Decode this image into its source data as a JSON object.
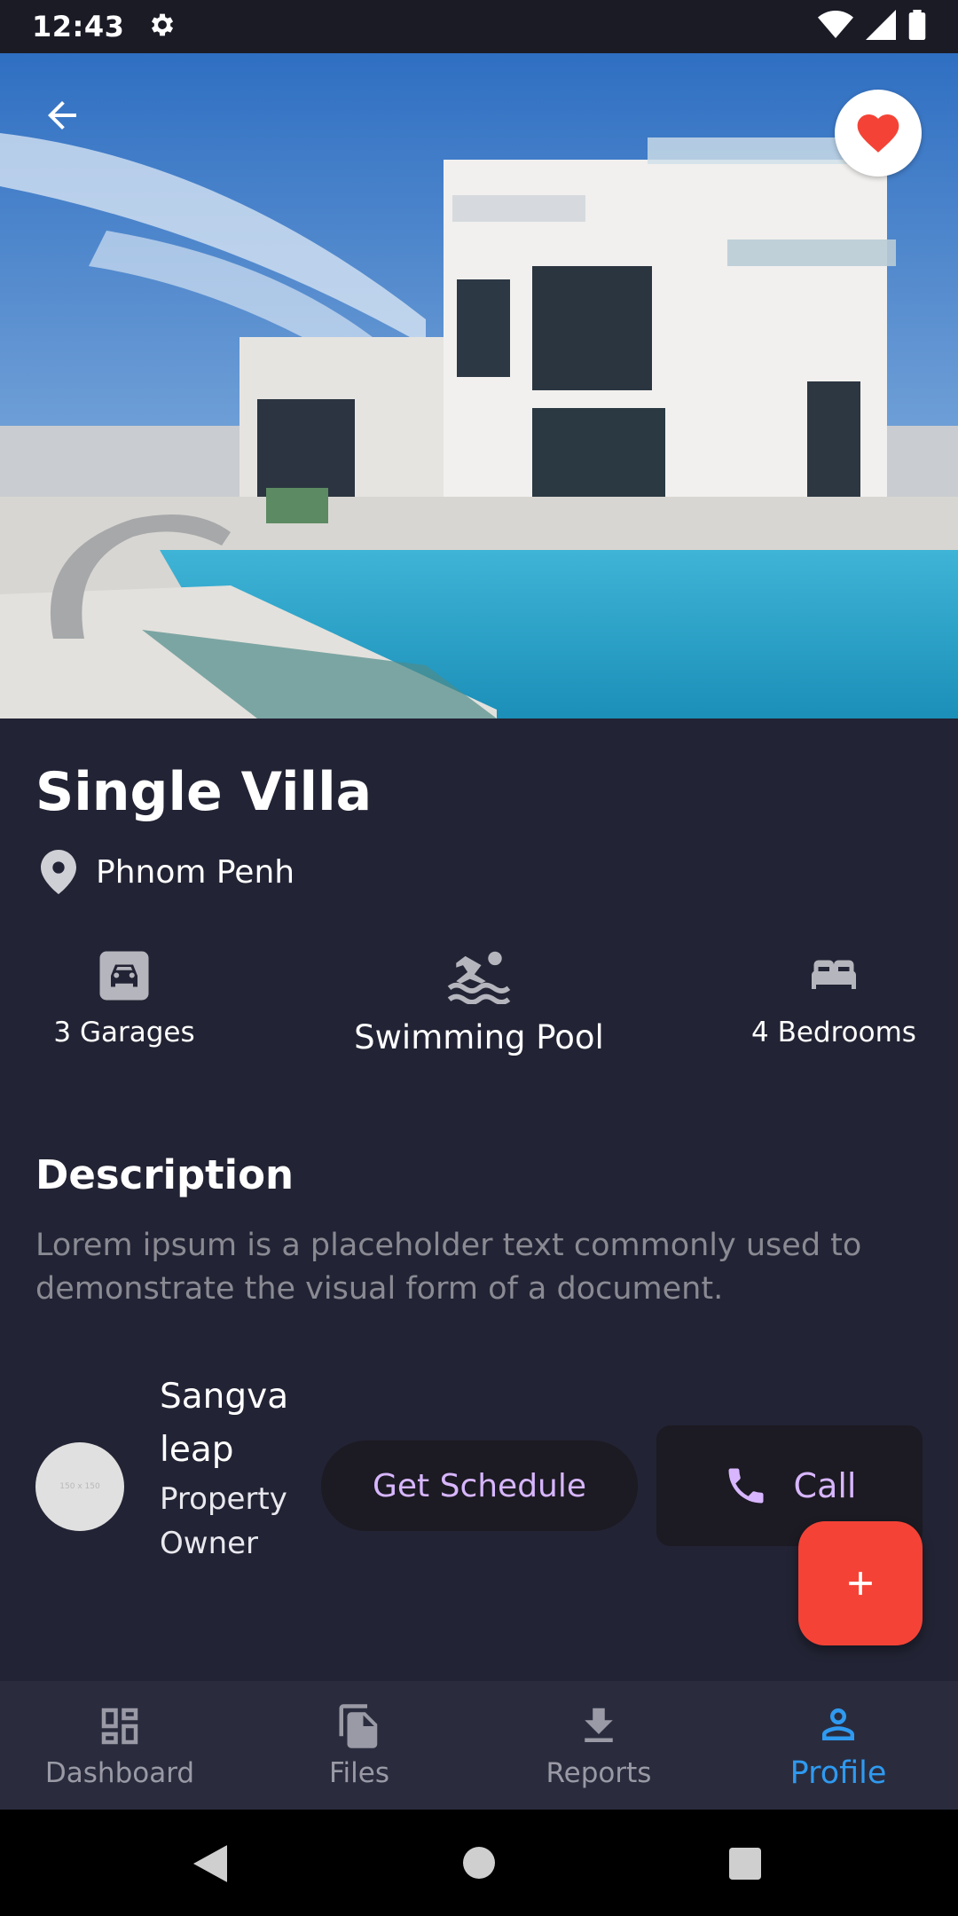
{
  "status_bar": {
    "time": "12:43"
  },
  "property": {
    "title": "Single Villa",
    "location": "Phnom Penh",
    "features": [
      {
        "label": "3 Garages",
        "icon": "garage-icon"
      },
      {
        "label": "Swimming Pool",
        "icon": "pool-icon"
      },
      {
        "label": "4 Bedrooms",
        "icon": "bed-icon"
      }
    ],
    "description_title": "Description",
    "description_text": "Lorem ipsum is a placeholder text commonly used to demonstrate the visual form of a document."
  },
  "owner": {
    "avatar_placeholder": "150 x 150",
    "name": "Sangvaleap",
    "role": "Property Owner"
  },
  "actions": {
    "schedule_label": "Get Schedule",
    "call_label": "Call"
  },
  "bottom_nav": [
    {
      "label": "Dashboard",
      "icon": "dashboard-icon"
    },
    {
      "label": "Files",
      "icon": "files-icon"
    },
    {
      "label": "Reports",
      "icon": "download-icon"
    },
    {
      "label": "Profile",
      "icon": "person-icon",
      "active": true
    }
  ],
  "colors": {
    "background": "#222334",
    "accent": "#2f9af0",
    "fab": "#f44336",
    "button_text": "#d7b6ff",
    "favorite": "#f44336"
  }
}
